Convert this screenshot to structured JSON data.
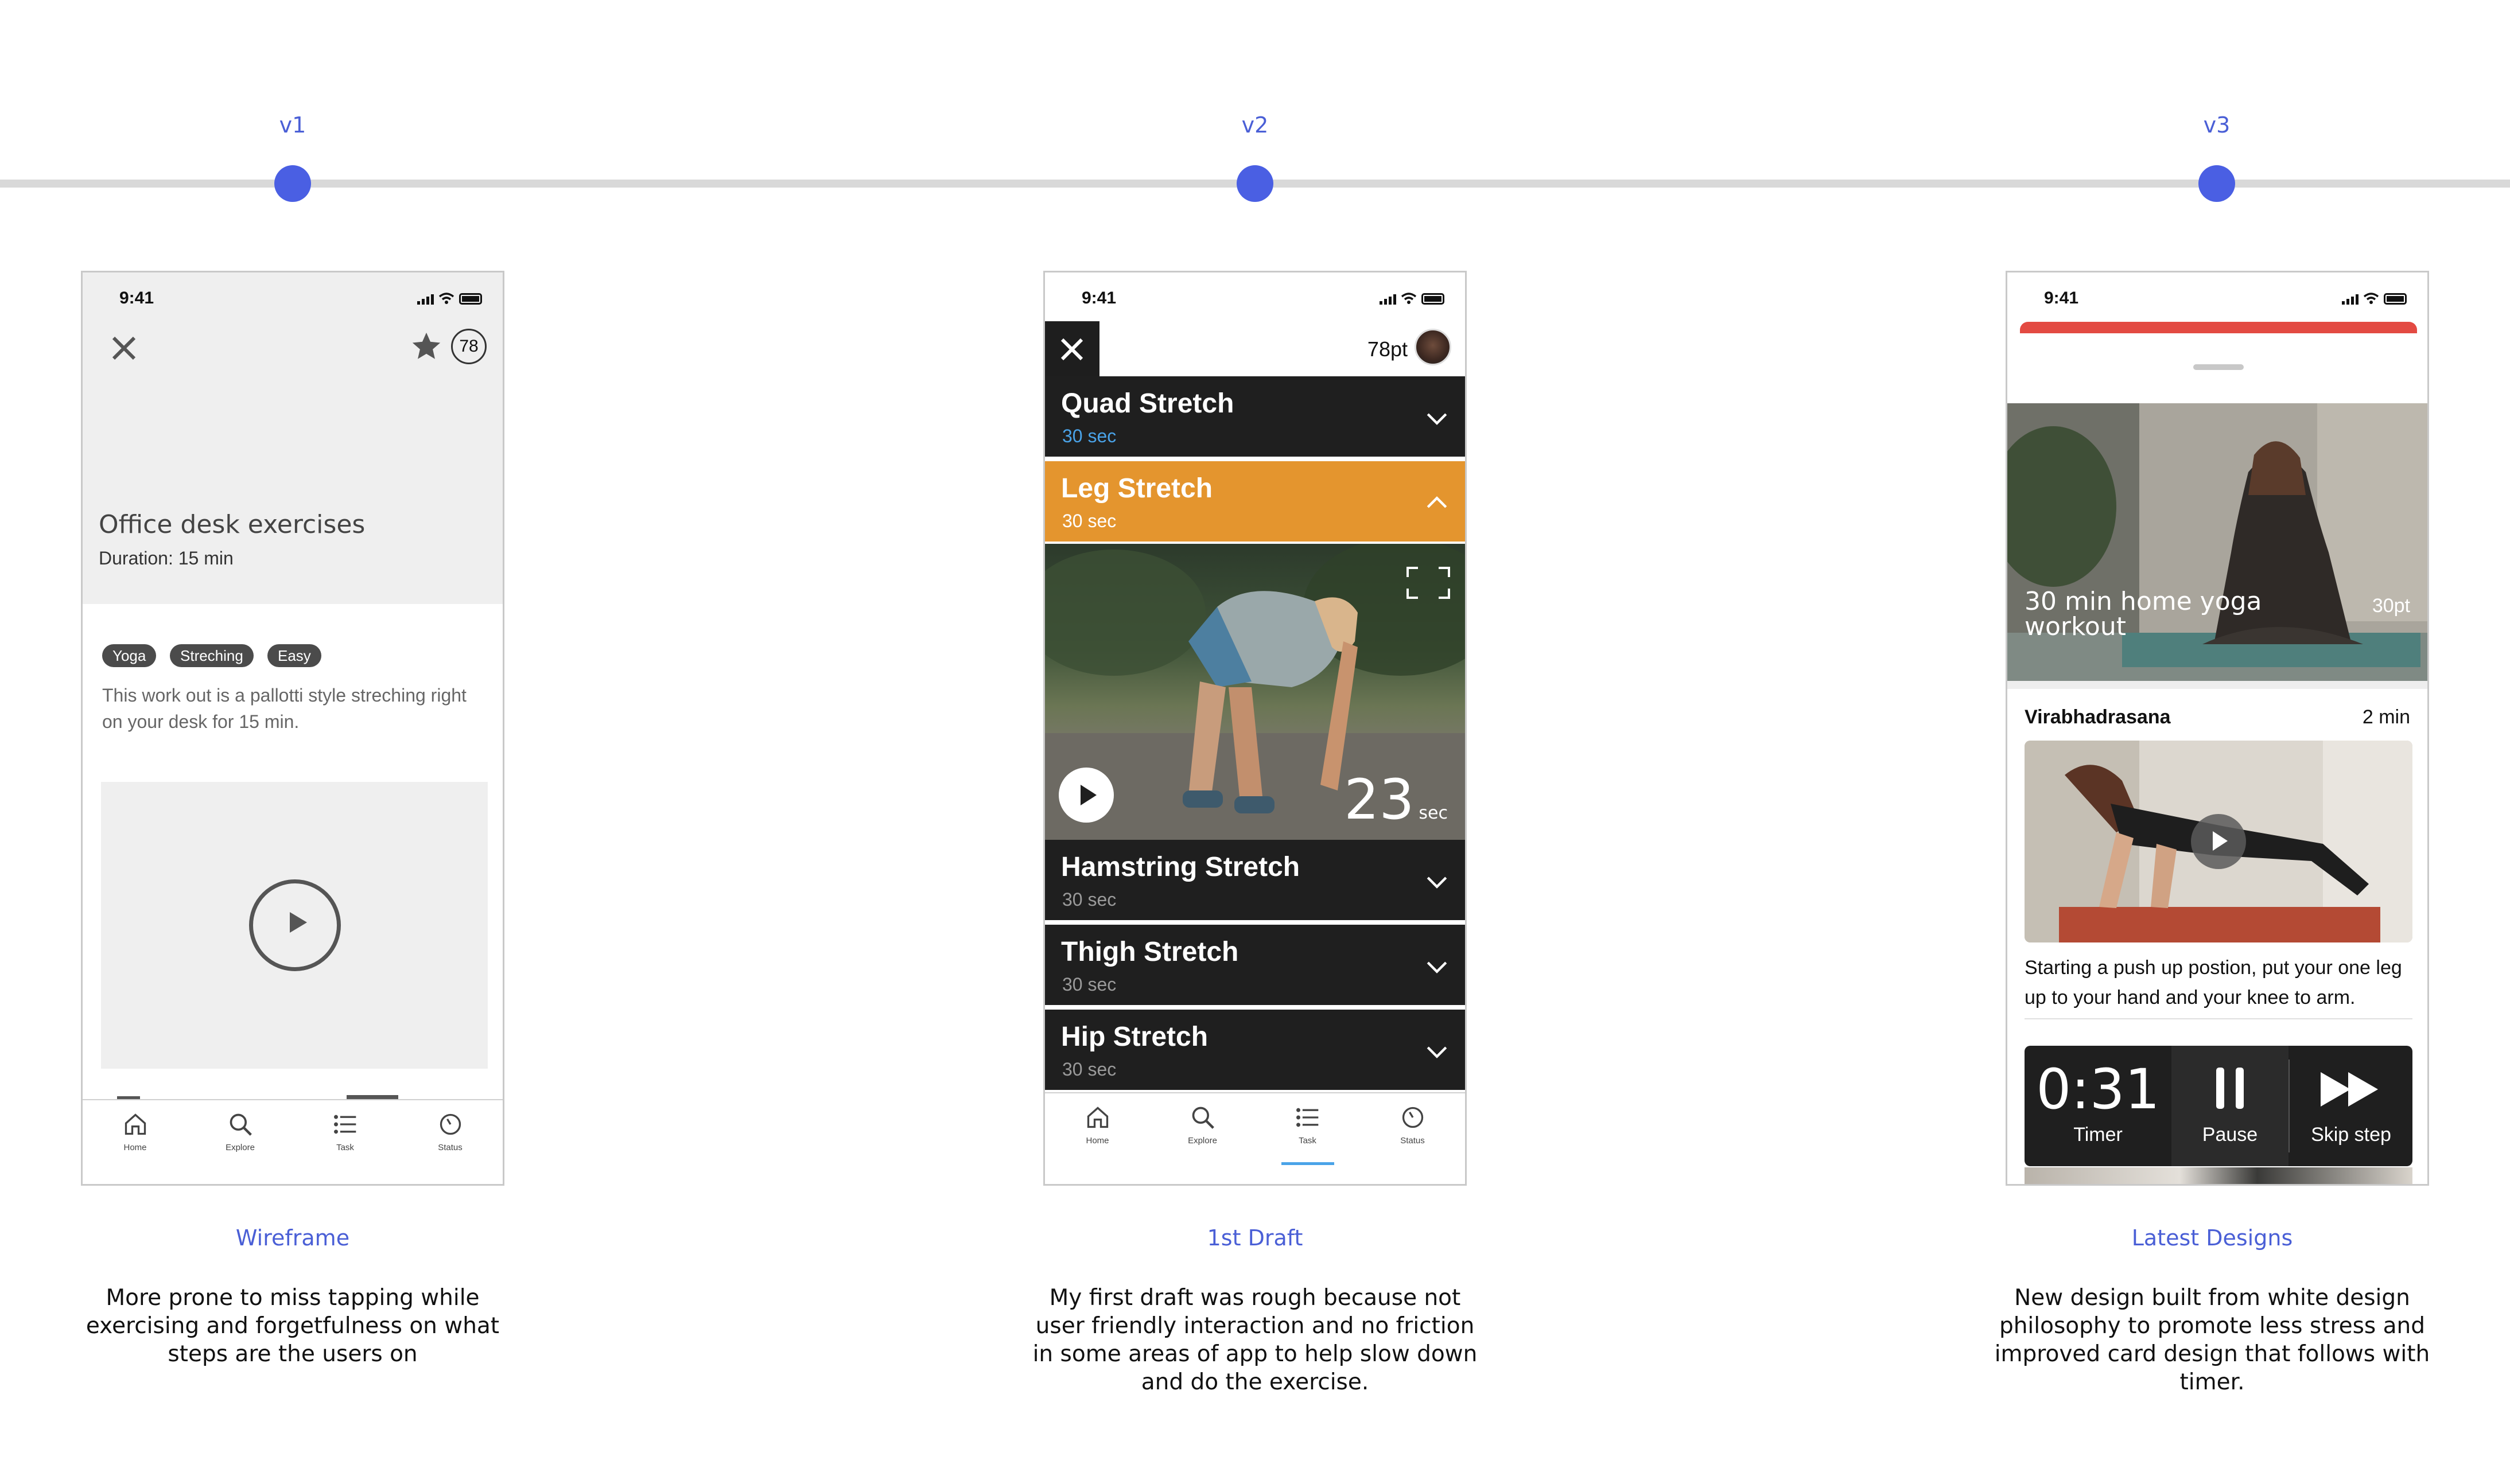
{
  "timeline": {
    "versions": [
      "v1",
      "v2",
      "v3"
    ],
    "accent_color": "#4a5fe3"
  },
  "v1": {
    "status_time": "9:41",
    "favorite_count": "78",
    "title": "Office desk exercises",
    "duration": "Duration: 15 min",
    "tags": [
      "Yoga",
      "Streching",
      "Easy"
    ],
    "description": "This work out is a pallotti style streching right on your desk for 15 min.",
    "tabs": [
      "Home",
      "Explore",
      "Task",
      "Status"
    ]
  },
  "v2": {
    "status_time": "9:41",
    "points": "78pt",
    "exercises": [
      {
        "name": "Quad Stretch",
        "duration": "30 sec"
      },
      {
        "name": "Leg Stretch",
        "duration": "30 sec"
      },
      {
        "name": "Hamstring Stretch",
        "duration": "30 sec"
      },
      {
        "name": "Thigh Stretch",
        "duration": "30 sec"
      },
      {
        "name": "Hip Stretch",
        "duration": "30 sec"
      }
    ],
    "timer_value": "23",
    "timer_unit": "sec",
    "tabs": [
      "Home",
      "Explore",
      "Task",
      "Status"
    ],
    "active_color": "#e4952e",
    "link_color": "#4aa3e8"
  },
  "v3": {
    "status_time": "9:41",
    "hero_title": "30 min home yoga workout",
    "hero_points": "30pt",
    "exercise_name": "Virabhadrasana",
    "exercise_duration": "2 min",
    "description": "Starting a push up postion, put your one leg up to your hand and your knee to arm.",
    "timer_value": "0:31",
    "timer_label": "Timer",
    "pause_label": "Pause",
    "skip_label": "Skip step",
    "accent_color": "#e34a42"
  },
  "captions": [
    {
      "title": "Wireframe",
      "body": "More prone to miss tapping while exercising and forgetfulness on what steps are the users on"
    },
    {
      "title": "1st Draft",
      "body": "My first draft was rough because not user friendly interaction and no friction in some areas of app to help slow down and do the exercise."
    },
    {
      "title": "Latest Designs",
      "body": "New design built from white design philosophy to promote less stress and improved card design that follows with timer."
    }
  ]
}
